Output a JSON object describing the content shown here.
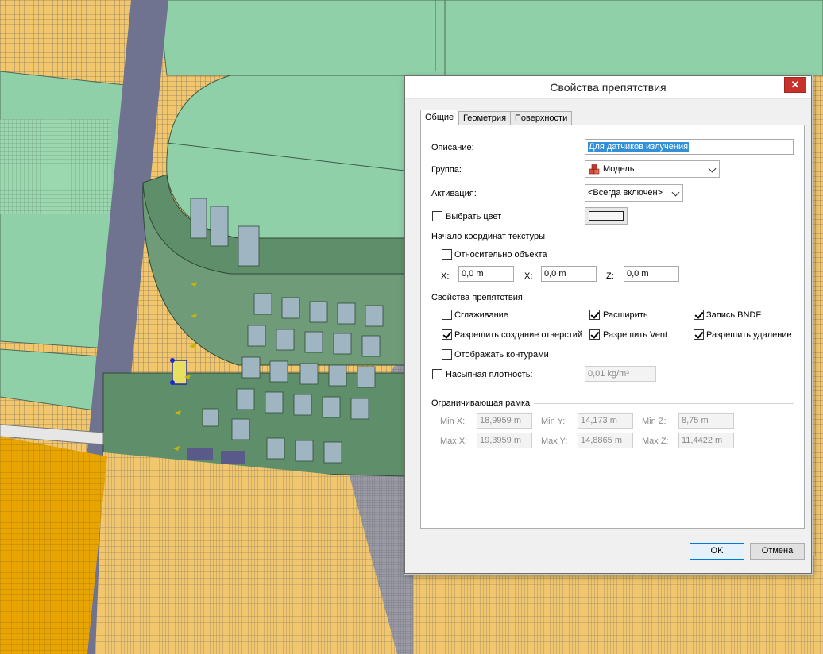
{
  "dialog": {
    "title": "Свойства препятствия",
    "close_symbol": "✕"
  },
  "tabs": [
    {
      "label": "Общие",
      "active": true
    },
    {
      "label": "Геометрия",
      "active": false
    },
    {
      "label": "Поверхности",
      "active": false
    }
  ],
  "general": {
    "description_label": "Описание:",
    "description_value": "Для датчиков излучения",
    "group_label": "Группа:",
    "group_value": "Модель",
    "group_icon": "model-blocks-icon",
    "activation_label": "Активация:",
    "activation_value": "<Всегда включен>",
    "pick_color_label": "Выбрать цвет",
    "pick_color_checked": false
  },
  "texture_origin": {
    "heading": "Начало координат текстуры",
    "relative_label": "Относительно объекта",
    "relative_checked": false,
    "x_label": "X:",
    "x_value": "0,0 m",
    "y_label": "X:",
    "y_value": "0,0 m",
    "z_label": "Z:",
    "z_value": "0,0 m"
  },
  "obstruction": {
    "heading": "Свойства препятствия",
    "smoothing_label": "Сглаживание",
    "smoothing_checked": false,
    "expand_label": "Расширить",
    "expand_checked": true,
    "bndf_label": "Запись BNDF",
    "bndf_checked": true,
    "holes_label": "Разрешить создание отверстий",
    "holes_checked": true,
    "vent_label": "Разрешить Vent",
    "vent_checked": true,
    "remove_label": "Разрешить удаление",
    "remove_checked": true,
    "outline_label": "Отображать контурами",
    "outline_checked": false,
    "bulk_density_label": "Насыпная плотность:",
    "bulk_density_checked": false,
    "bulk_density_value": "0,01 kg/m³"
  },
  "bounding_box": {
    "heading": "Ограничивающая рамка",
    "min_x_label": "Min X:",
    "min_x": "18,9959 m",
    "min_y_label": "Min Y:",
    "min_y": "14,173 m",
    "min_z_label": "Min Z:",
    "min_z": "8,75 m",
    "max_x_label": "Max X:",
    "max_x": "19,3959 m",
    "max_y_label": "Max Y:",
    "max_y": "14,8865 m",
    "max_z_label": "Max Z:",
    "max_z": "11,4422 m"
  },
  "buttons": {
    "ok": "OK",
    "cancel": "Отмена"
  },
  "colors": {
    "scene_green": "#8fd0a8",
    "scene_mesh_yellow": "#f0c46a",
    "scene_road": "#6f7390",
    "facade": "#5f8f6a",
    "selection_blue": "#3390d6",
    "close_red": "#c7312b"
  }
}
